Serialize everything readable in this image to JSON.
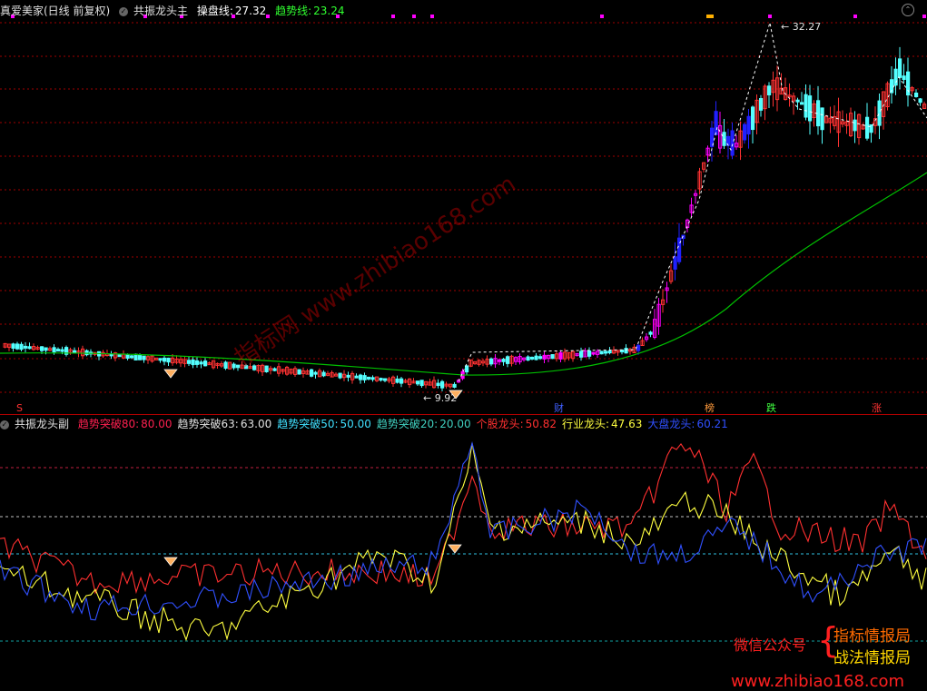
{
  "colors": {
    "up": "#ff3232",
    "down": "#54ffff",
    "magenta": "#ff00ff",
    "blue": "#2020ff",
    "yellow": "#ffff40",
    "ma": "#00c000",
    "grid": "#a00000",
    "teal": "#0fa0a0"
  },
  "main_header": {
    "stock": "真爱美家(日线 前复权)",
    "indicator": "共振龙头主",
    "line1_label": "操盘线:",
    "line1_value": "27.32",
    "line2_label": "趋势线:",
    "line2_value": "23.24"
  },
  "price_labels": {
    "high": "32.27",
    "low": "9.92"
  },
  "events": [
    {
      "name": "s-marker",
      "text": "S",
      "color": "#ff3232"
    },
    {
      "name": "cai-marker",
      "text": "财",
      "color": "#4060ff"
    },
    {
      "name": "bang-marker",
      "text": "榜",
      "color": "#ff9a3c"
    },
    {
      "name": "die-marker",
      "text": "跌",
      "color": "#40ff40"
    },
    {
      "name": "zhang-marker",
      "text": "涨",
      "color": "#ff3232"
    }
  ],
  "sub_header": {
    "indicator": "共振龙头副",
    "items": [
      {
        "label": "趋势突破80:",
        "value": "80.00",
        "color": "#ff2050"
      },
      {
        "label": "趋势突破63:",
        "value": "63.00",
        "color": "#e0e0e0"
      },
      {
        "label": "趋势突破50:",
        "value": "50.00",
        "color": "#40e0ff"
      },
      {
        "label": "趋势突破20:",
        "value": "20.00",
        "color": "#40d0c0"
      },
      {
        "label": "个股龙头:",
        "value": "50.82",
        "color": "#ff3030"
      },
      {
        "label": "行业龙头:",
        "value": "47.63",
        "color": "#ffff40"
      },
      {
        "label": "大盘龙头:",
        "value": "60.21",
        "color": "#3050ff"
      }
    ]
  },
  "watermarks": {
    "diagonal": "指标网 www.zhibiao168.com",
    "wechat": "微信公众号",
    "brand1": "指标情报局",
    "brand2": "战法情报局",
    "url": "www.zhibiao168.com"
  }
}
